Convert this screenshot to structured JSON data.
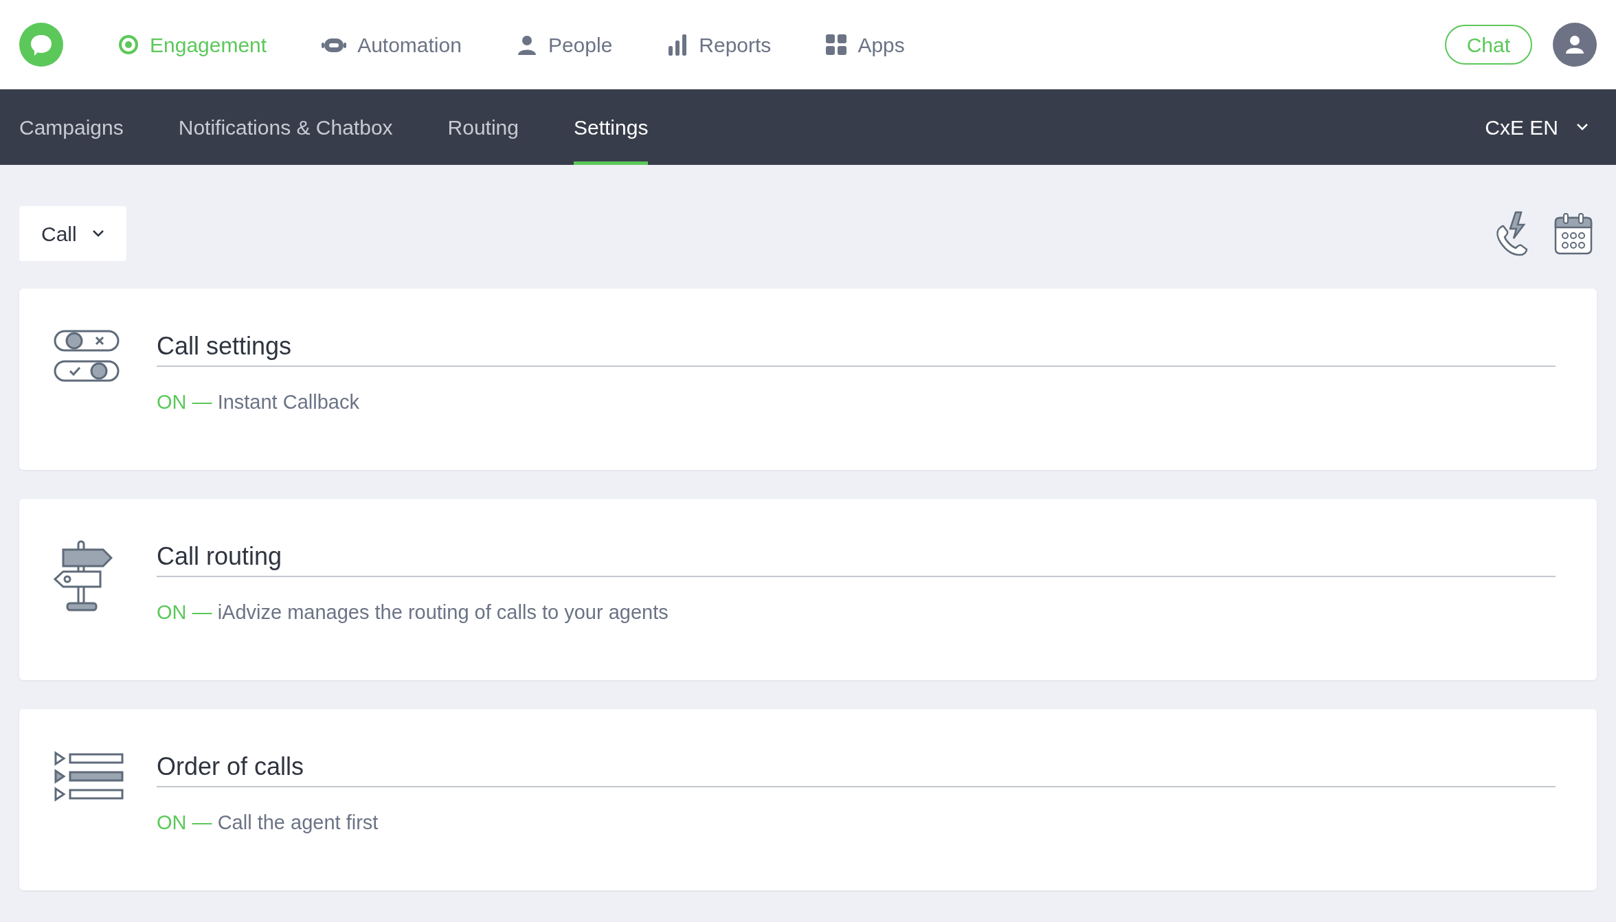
{
  "top_nav": [
    {
      "label": "Engagement",
      "kind": "target",
      "selected": true
    },
    {
      "label": "Automation",
      "kind": "robot",
      "selected": false
    },
    {
      "label": "People",
      "kind": "person",
      "selected": false
    },
    {
      "label": "Reports",
      "kind": "bars",
      "selected": false
    },
    {
      "label": "Apps",
      "kind": "grid",
      "selected": false
    }
  ],
  "chat_button": "Chat",
  "sub_nav": [
    {
      "label": "Campaigns",
      "selected": false
    },
    {
      "label": "Notifications & Chatbox",
      "selected": false
    },
    {
      "label": "Routing",
      "selected": false
    },
    {
      "label": "Settings",
      "selected": true
    }
  ],
  "workspace": "CxE EN",
  "channel_select": "Call",
  "cards": [
    {
      "kind": "toggles",
      "title": "Call settings",
      "status": "ON —",
      "text": "Instant Callback"
    },
    {
      "kind": "signpost",
      "title": "Call routing",
      "status": "ON —",
      "text": "iAdvize manages the routing of calls to your agents"
    },
    {
      "kind": "list",
      "title": "Order of calls",
      "status": "ON —",
      "text": "Call the agent first"
    }
  ]
}
